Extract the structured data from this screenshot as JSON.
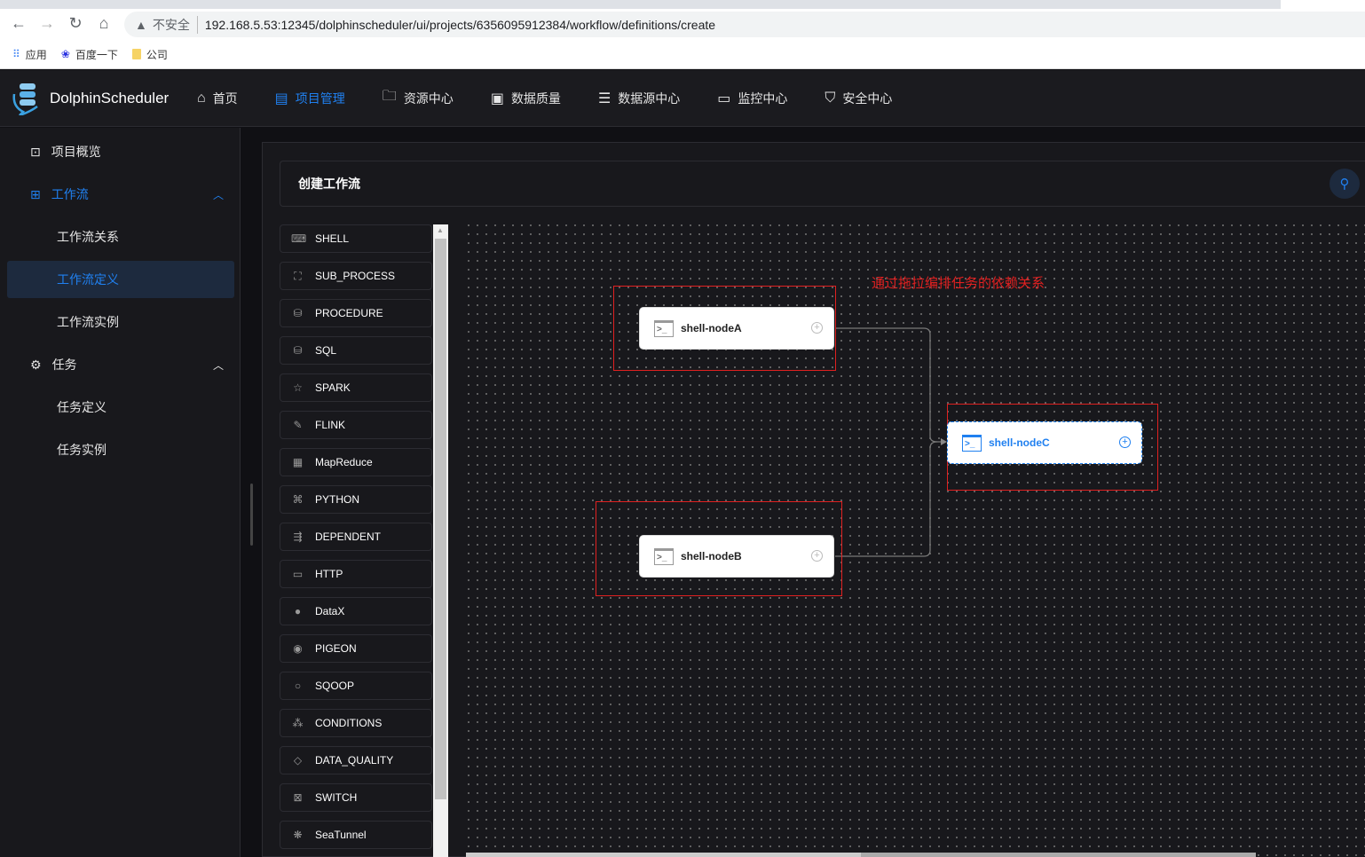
{
  "browser": {
    "url": "192.168.5.53:12345/dolphinscheduler/ui/projects/6356095912384/workflow/definitions/create",
    "security_label": "不安全",
    "bookmarks": [
      "应用",
      "百度一下",
      "公司"
    ]
  },
  "header": {
    "brand": "DolphinScheduler",
    "menu": [
      {
        "label": "首页",
        "icon": "home-icon"
      },
      {
        "label": "项目管理",
        "icon": "project-icon",
        "active": true
      },
      {
        "label": "资源中心",
        "icon": "folder-icon"
      },
      {
        "label": "数据质量",
        "icon": "data-quality-icon"
      },
      {
        "label": "数据源中心",
        "icon": "datasource-icon"
      },
      {
        "label": "监控中心",
        "icon": "monitor-icon"
      },
      {
        "label": "安全中心",
        "icon": "shield-icon"
      }
    ]
  },
  "sidebar": {
    "items": [
      {
        "label": "项目概览"
      },
      {
        "label": "工作流"
      },
      {
        "label": "工作流关系"
      },
      {
        "label": "工作流定义",
        "selected": true
      },
      {
        "label": "工作流实例"
      },
      {
        "label": "任务"
      },
      {
        "label": "任务定义"
      },
      {
        "label": "任务实例"
      }
    ]
  },
  "page": {
    "title": "创建工作流"
  },
  "tasks": [
    "SHELL",
    "SUB_PROCESS",
    "PROCEDURE",
    "SQL",
    "SPARK",
    "FLINK",
    "MapReduce",
    "PYTHON",
    "DEPENDENT",
    "HTTP",
    "DataX",
    "PIGEON",
    "SQOOP",
    "CONDITIONS",
    "DATA_QUALITY",
    "SWITCH",
    "SeaTunnel"
  ],
  "canvas": {
    "annotation": "通过拖拉编排任务的依赖关系",
    "nodes": [
      {
        "name": "shell-nodeA"
      },
      {
        "name": "shell-nodeB"
      },
      {
        "name": "shell-nodeC",
        "selected": true
      }
    ],
    "edges": [
      [
        "shell-nodeA",
        "shell-nodeC"
      ],
      [
        "shell-nodeB",
        "shell-nodeC"
      ]
    ]
  },
  "colors": {
    "accent": "#2080f0",
    "annotation": "#e02020",
    "background": "#18181c"
  }
}
